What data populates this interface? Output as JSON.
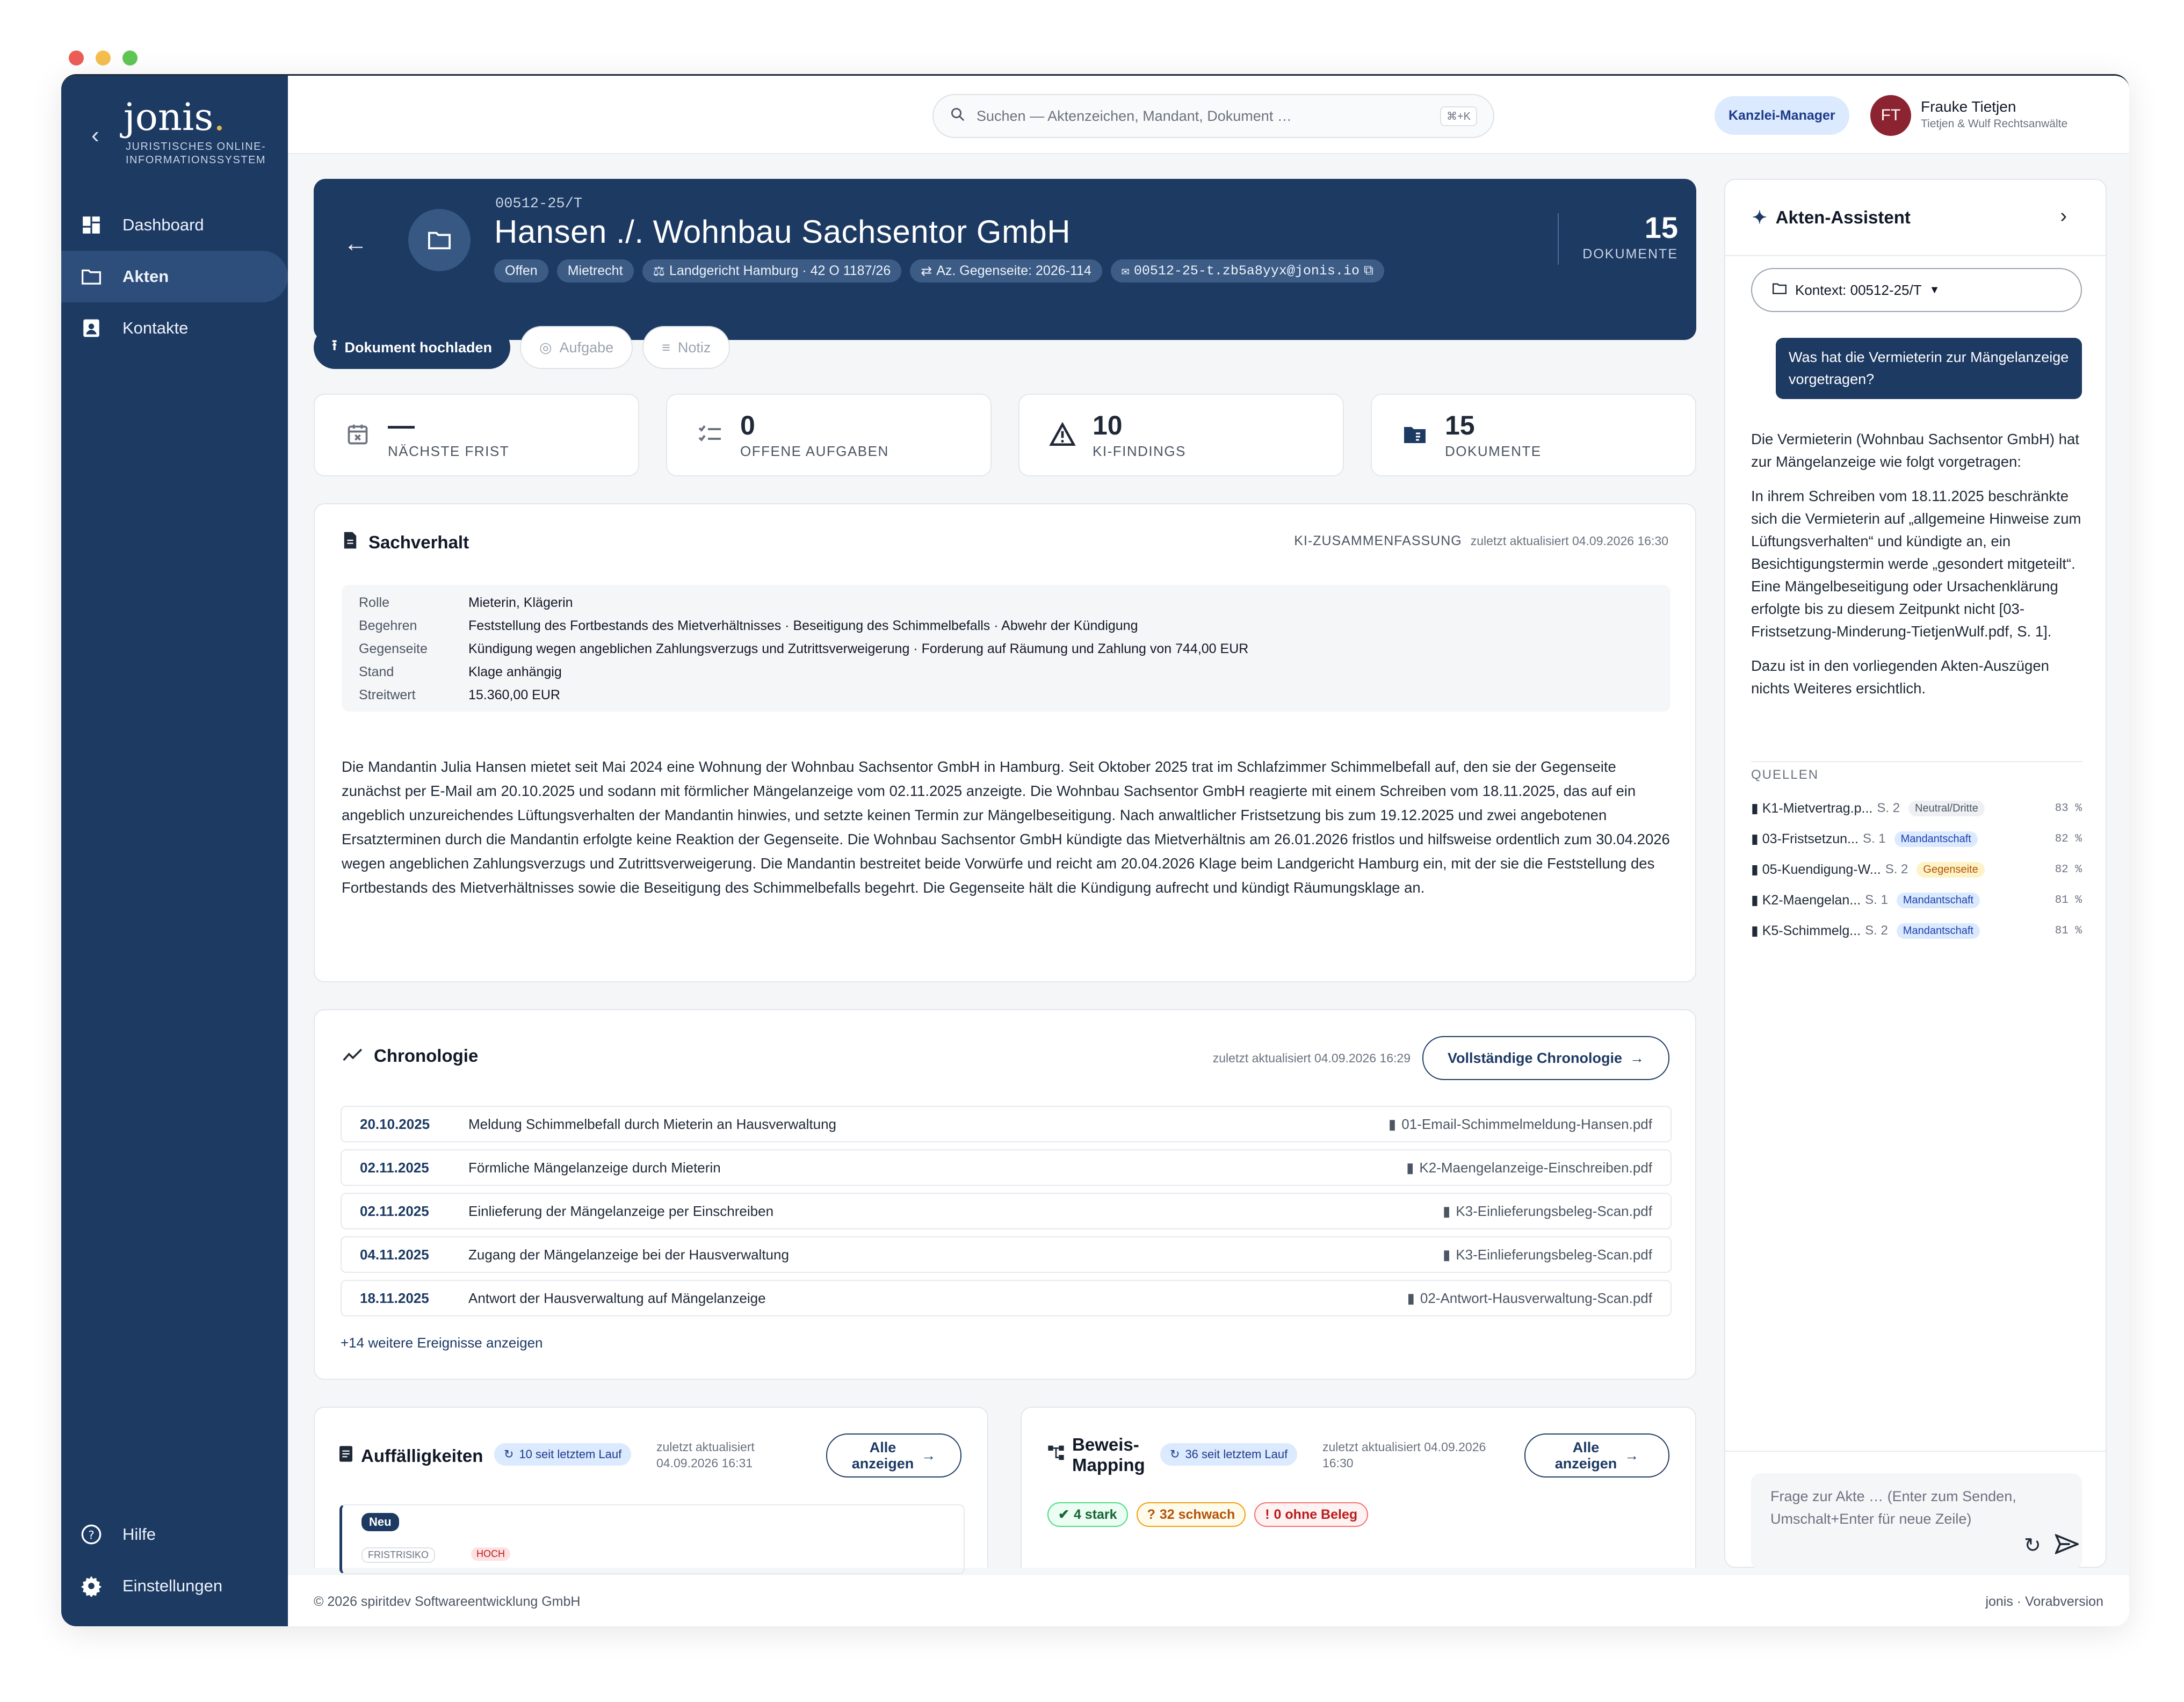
{
  "window": {
    "dot_colors": [
      "#ec5d57",
      "#f4bf4f",
      "#5fc653"
    ]
  },
  "sidebar": {
    "logo": "jonis",
    "logo_dot": ".",
    "subtitle": "JURISTISCHES ONLINE-INFORMATIONSSYSTEM",
    "items": [
      {
        "label": "Dashboard",
        "icon": "dashboard-icon"
      },
      {
        "label": "Akten",
        "icon": "folder-icon"
      },
      {
        "label": "Kontakte",
        "icon": "contacts-icon"
      }
    ],
    "bottom": [
      {
        "label": "Hilfe",
        "icon": "help-icon"
      },
      {
        "label": "Einstellungen",
        "icon": "gear-icon"
      }
    ]
  },
  "topbar": {
    "search_placeholder": "Suchen — Aktenzeichen, Mandant, Dokument …",
    "shortcut": "⌘+K",
    "role": "Kanzlei-Manager",
    "avatar": "FT",
    "user_name": "Frauke Tietjen",
    "user_firm": "Tietjen & Wulf Rechtsanwälte"
  },
  "case": {
    "number": "00512-25/T",
    "title": "Hansen ./. Wohnbau Sachsentor GmbH",
    "tags": {
      "status": "Offen",
      "area": "Mietrecht",
      "court": "Landgericht Hamburg · 42 O 1187/26",
      "opponent_ref": "Az. Gegenseite: 2026-114",
      "email": "00512-25-t.zb5a8yyx@jonis.io"
    },
    "doc_count": "15",
    "doc_label": "DOKUMENTE"
  },
  "actions": {
    "upload": "Dokument hochladen",
    "task": "Aufgabe",
    "note": "Notiz"
  },
  "stats": [
    {
      "value": "—",
      "label": "NÄCHSTE FRIST",
      "icon": "calendar-x-icon"
    },
    {
      "value": "0",
      "label": "OFFENE AUFGABEN",
      "icon": "checklist-icon"
    },
    {
      "value": "10",
      "label": "KI-FINDINGS",
      "icon": "warning-icon"
    },
    {
      "value": "15",
      "label": "DOKUMENTE",
      "icon": "document-folder-icon"
    }
  ],
  "sachverhalt": {
    "title": "Sachverhalt",
    "ki_label": "KI-ZUSAMMENFASSUNG",
    "updated": "zuletzt aktualisiert 04.09.2026 16:30",
    "facts": [
      {
        "key": "Rolle",
        "value": "Mieterin, Klägerin"
      },
      {
        "key": "Begehren",
        "value": "Feststellung des Fortbestands des Mietverhältnisses · Beseitigung des Schimmelbefalls · Abwehr der Kündigung"
      },
      {
        "key": "Gegenseite",
        "value": "Kündigung wegen angeblichen Zahlungsverzugs und Zutrittsverweigerung · Forderung auf Räumung und Zahlung von 744,00 EUR"
      },
      {
        "key": "Stand",
        "value": "Klage anhängig"
      },
      {
        "key": "Streitwert",
        "value": "15.360,00 EUR"
      }
    ],
    "text": "Die Mandantin Julia Hansen mietet seit Mai 2024 eine Wohnung der Wohnbau Sachsentor GmbH in Hamburg. Seit Oktober 2025 trat im Schlafzimmer Schimmelbefall auf, den sie der Gegenseite zunächst per E-Mail am 20.10.2025 und sodann mit förmlicher Mängelanzeige vom 02.11.2025 anzeigte. Die Wohnbau Sachsentor GmbH reagierte mit einem Schreiben vom 18.11.2025, das auf ein angeblich unzureichendes Lüftungsverhalten der Mandantin hinwies, und setzte keinen Termin zur Mängelbeseitigung. Nach anwaltlicher Fristsetzung bis zum 19.12.2025 und zwei angebotenen Ersatzterminen durch die Mandantin erfolgte keine Reaktion der Gegenseite. Die Wohnbau Sachsentor GmbH kündigte das Mietverhältnis am 26.01.2026 fristlos und hilfsweise ordentlich zum 30.04.2026 wegen angeblichen Zahlungsverzugs und Zutrittsverweigerung. Die Mandantin bestreitet beide Vorwürfe und reicht am 20.04.2026 Klage beim Landgericht Hamburg ein, mit der sie die Feststellung des Fortbestands des Mietverhältnisses sowie die Beseitigung des Schimmelbefalls begehrt. Die Gegenseite hält die Kündigung aufrecht und kündigt Räumungsklage an."
  },
  "chronologie": {
    "title": "Chronologie",
    "updated": "zuletzt aktualisiert 04.09.2026 16:29",
    "button": "Vollständige Chronologie",
    "rows": [
      {
        "date": "20.10.2025",
        "event": "Meldung Schimmelbefall durch Mieterin an Hausverwaltung",
        "file": "01-Email-Schimmelmeldung-Hansen.pdf"
      },
      {
        "date": "02.11.2025",
        "event": "Förmliche Mängelanzeige durch Mieterin",
        "file": "K2-Maengelanzeige-Einschreiben.pdf"
      },
      {
        "date": "02.11.2025",
        "event": "Einlieferung der Mängelanzeige per Einschreiben",
        "file": "K3-Einlieferungsbeleg-Scan.pdf"
      },
      {
        "date": "04.11.2025",
        "event": "Zugang der Mängelanzeige bei der Hausverwaltung",
        "file": "K3-Einlieferungsbeleg-Scan.pdf"
      },
      {
        "date": "18.11.2025",
        "event": "Antwort der Hausverwaltung auf Mängelanzeige",
        "file": "02-Antwort-Hausverwaltung-Scan.pdf"
      }
    ],
    "more": "+14 weitere Ereignisse anzeigen"
  },
  "auffaelligkeiten": {
    "title": "Auffälligkeiten",
    "run": "10 seit letztem Lauf",
    "updated_1": "zuletzt aktualisiert",
    "updated_2": "04.09.2026 16:31",
    "button_1": "Alle",
    "button_2": "anzeigen",
    "badge": "Neu",
    "partial_1": "FRISTRISIKO",
    "partial_2": "HOCH"
  },
  "beweis": {
    "title_1": "Beweis-",
    "title_2": "Mapping",
    "run": "36 seit letztem Lauf",
    "updated_1": "zuletzt aktualisiert 04.09.2026",
    "updated_2": "16:30",
    "button_1": "Alle",
    "button_2": "anzeigen",
    "pills": {
      "strong": "4 stark",
      "weak": "32 schwach",
      "none": "0 ohne Beleg"
    }
  },
  "assistant": {
    "title": "Akten-Assistent",
    "context": "Kontext: 00512-25/T",
    "question": "Was hat die Vermieterin zur Mängelanzeige vorgetragen?",
    "answer_1": "Die Vermieterin (Wohnbau Sachsentor GmbH) hat zur Mängelanzeige wie folgt vorgetragen:",
    "answer_2": "In ihrem Schreiben vom 18.11.2025 beschränkte sich die Vermieterin auf „allgemeine Hinweise zum Lüftungsverhalten“ und kündigte an, ein Besichtigungstermin werde „gesondert mitgeteilt“. Eine Mängelbeseitigung oder Ursachenklärung erfolgte bis zu diesem Zeitpunkt nicht [03-Fristsetzung-Minderung-TietjenWulf.pdf, S. 1].",
    "answer_3": "Dazu ist in den vorliegenden Akten-Auszügen nichts Weiteres ersichtlich.",
    "sources_label": "QUELLEN",
    "sources": [
      {
        "name": "K1-Mietvertrag.p...",
        "page": "S. 2",
        "badge": "Neutral/Dritte",
        "pct": "83 %"
      },
      {
        "name": "03-Fristsetzun...",
        "page": "S. 1",
        "badge": "Mandantschaft",
        "pct": "82 %"
      },
      {
        "name": "05-Kuendigung-W...",
        "page": "S. 2",
        "badge": "Gegenseite",
        "pct": "82 %"
      },
      {
        "name": "K2-Maengelan...",
        "page": "S. 1",
        "badge": "Mandantschaft",
        "pct": "81 %"
      },
      {
        "name": "K5-Schimmelg...",
        "page": "S. 2",
        "badge": "Mandantschaft",
        "pct": "81 %"
      }
    ],
    "input_placeholder": "Frage zur Akte … (Enter zum Senden, Umschalt+Enter für neue Zeile)"
  },
  "footer": {
    "left": "© 2026 spiritdev Softwareentwicklung GmbH",
    "right": "jonis · Vorabversion"
  }
}
